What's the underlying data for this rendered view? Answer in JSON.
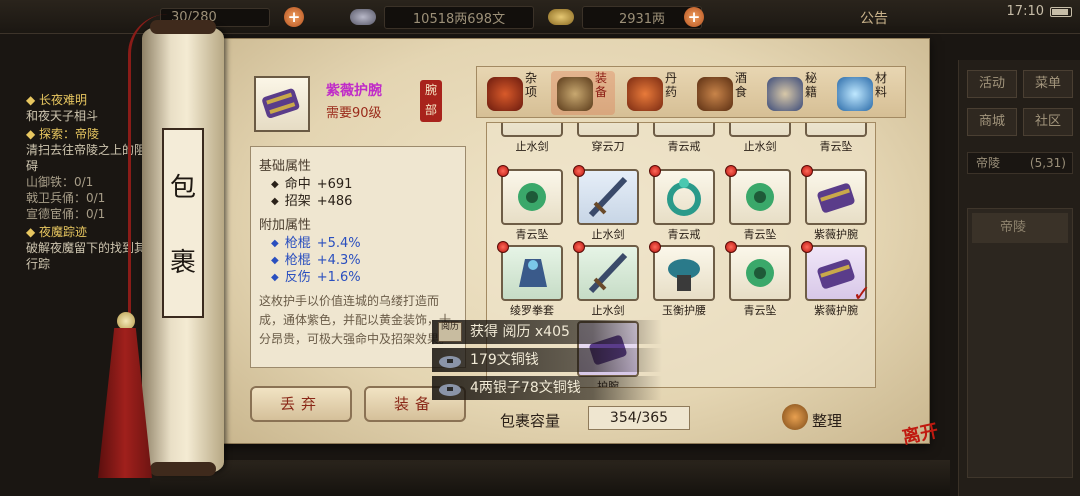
{
  "topbar": {
    "bag_count": "30/280",
    "copper": "10518两698文",
    "silver": "2931两",
    "announce": "公告",
    "time": "17:10"
  },
  "quests": [
    {
      "title": "◆ 长夜难明",
      "desc": "和夜天子相斗"
    },
    {
      "title": "◆ 探索：帝陵",
      "desc": "清扫去往帝陵之上的阻碍",
      "subs": [
        "山御铁：0/1",
        "戟卫兵俑：0/1",
        "宣德宦俑：0/1"
      ]
    },
    {
      "title": "◆ 夜魔踪迹",
      "desc": "破解夜魔留下的找到其行踪"
    }
  ],
  "right_panel": {
    "buttons": [
      "活动",
      "菜单",
      "商城",
      "社区"
    ],
    "location": "帝陵",
    "coords": "(5,31)",
    "list_item": "帝陵"
  },
  "scroll": {
    "title_chars": [
      "包",
      "裹"
    ]
  },
  "item": {
    "name": "紫薇护腕",
    "requirement": "需要90级",
    "slot": "腕部",
    "base_label": "基础属性",
    "base_stats": [
      {
        "k": "命中",
        "v": "+691"
      },
      {
        "k": "招架",
        "v": "+486"
      }
    ],
    "extra_label": "附加属性",
    "extra_stats": [
      {
        "k": "枪棍",
        "v": "+5.4%"
      },
      {
        "k": "枪棍",
        "v": "+4.3%"
      },
      {
        "k": "反伤",
        "v": "+1.6%"
      }
    ],
    "description": "这枚护手以价值连城的乌缕打造而成，通体紫色，并配以黄金装饰，十分昂贵，可极大强命中及招架效果。"
  },
  "actions": {
    "discard": "丢弃",
    "equip": "装备"
  },
  "categories": [
    {
      "label": "杂项",
      "color": "#b23a1e"
    },
    {
      "label": "装备",
      "color": "#8a6a3a",
      "active": true
    },
    {
      "label": "丹药",
      "color": "#c65a2a"
    },
    {
      "label": "酒食",
      "color": "#9a5a2a"
    },
    {
      "label": "秘籍",
      "color": "#4a6aa8"
    },
    {
      "label": "材料",
      "color": "#5aa8d8"
    }
  ],
  "grid": {
    "top_row": [
      "止水剑",
      "穿云刀",
      "青云戒",
      "止水剑",
      "青云坠"
    ],
    "rows": [
      [
        {
          "name": "青云坠",
          "icon": "pendant-icon",
          "dot": true
        },
        {
          "name": "止水剑",
          "icon": "sword-icon",
          "dot": true
        },
        {
          "name": "青云戒",
          "icon": "ring-icon",
          "dot": true
        },
        {
          "name": "青云坠",
          "icon": "pendant-icon",
          "dot": true
        },
        {
          "name": "紫薇护腕",
          "icon": "bracer-icon",
          "dot": true
        }
      ],
      [
        {
          "name": "绫罗拳套",
          "icon": "gauntlet-icon",
          "dot": true
        },
        {
          "name": "止水剑",
          "icon": "sword-icon",
          "dot": true
        },
        {
          "name": "玉衡护腰",
          "icon": "belt-icon",
          "dot": true
        },
        {
          "name": "青云坠",
          "icon": "pendant-icon",
          "dot": true
        },
        {
          "name": "紫薇护腕",
          "icon": "bracer-icon",
          "dot": true,
          "checked": true
        }
      ]
    ],
    "partial_label": "护腕"
  },
  "capacity": {
    "label": "包裹容量",
    "value": "354/365"
  },
  "sort_label": "整理",
  "toasts": [
    {
      "text": "获得 阅历 x405",
      "icon": "experience-icon",
      "badge": "阅历"
    },
    {
      "text": "179文铜钱",
      "icon": "copper-coin-icon"
    },
    {
      "text": "4两银子78文铜钱",
      "icon": "silver-coin-icon"
    }
  ],
  "leave_label": "离开",
  "colors": {
    "accent_red": "#a8231c",
    "item_purple": "#c02cc8",
    "attr_blue": "#2a4fbf"
  }
}
